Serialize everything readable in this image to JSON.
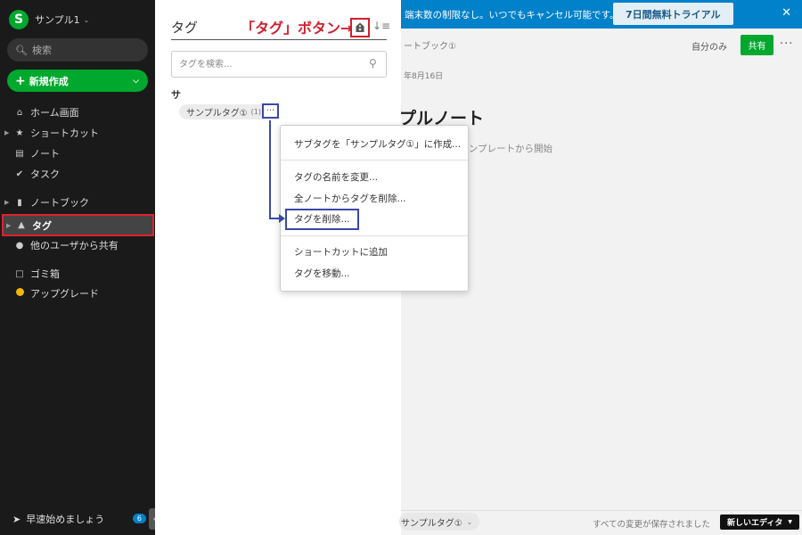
{
  "sidebar": {
    "logo_letter": "S",
    "account_name": "サンプル1",
    "search_label": "検索",
    "new_button_label": "新規作成",
    "items": [
      {
        "label": "ホーム画面",
        "icon": "home-icon"
      },
      {
        "label": "ショートカット",
        "icon": "star-icon"
      },
      {
        "label": "ノート",
        "icon": "note-icon"
      },
      {
        "label": "タスク",
        "icon": "check-circle-icon"
      },
      {
        "label": "ノートブック",
        "icon": "notebook-icon"
      },
      {
        "label": "タグ",
        "icon": "tag-icon"
      },
      {
        "label": "他のユーザから共有",
        "icon": "users-icon"
      },
      {
        "label": "ゴミ箱",
        "icon": "trash-icon"
      },
      {
        "label": "アップグレード",
        "icon": "coin-icon"
      }
    ],
    "getting_started_label": "早速始めましょう",
    "getting_started_badge": "6",
    "accent_color": "#00a82d",
    "highlight_color": "#e0222d"
  },
  "tag_panel": {
    "title": "タグ",
    "annotation": "「タグ」ボタン→",
    "search_placeholder": "タグを検索...",
    "group_letter": "サ",
    "tag_name": "サンプルタグ①",
    "tag_count": "(1)",
    "more_glyph": "···"
  },
  "context_menu": {
    "items": [
      "サブタグを「サンプルタグ①」に作成...",
      "タグの名前を変更...",
      "全ノートからタグを削除...",
      "タグを削除...",
      "ショートカットに追加",
      "タグを移動..."
    ],
    "callout_color": "#3b48a8"
  },
  "content": {
    "banner_text": "端末数の制限なし。いつでもキャンセル可能です。",
    "trial_button": "7日間無料トライアル",
    "banner_color": "#0081c9",
    "notebook_name": "ートブック①",
    "visibility": "自分のみ",
    "share_button": "共有",
    "note_date": "年8月16日",
    "note_title": "プルノート",
    "note_hint": "ッグ、またはテンプレートから開始",
    "footer_tag": "サンプルタグ①",
    "footer_status": "すべての変更が保存されました",
    "new_editor": "新しいエディタ"
  }
}
